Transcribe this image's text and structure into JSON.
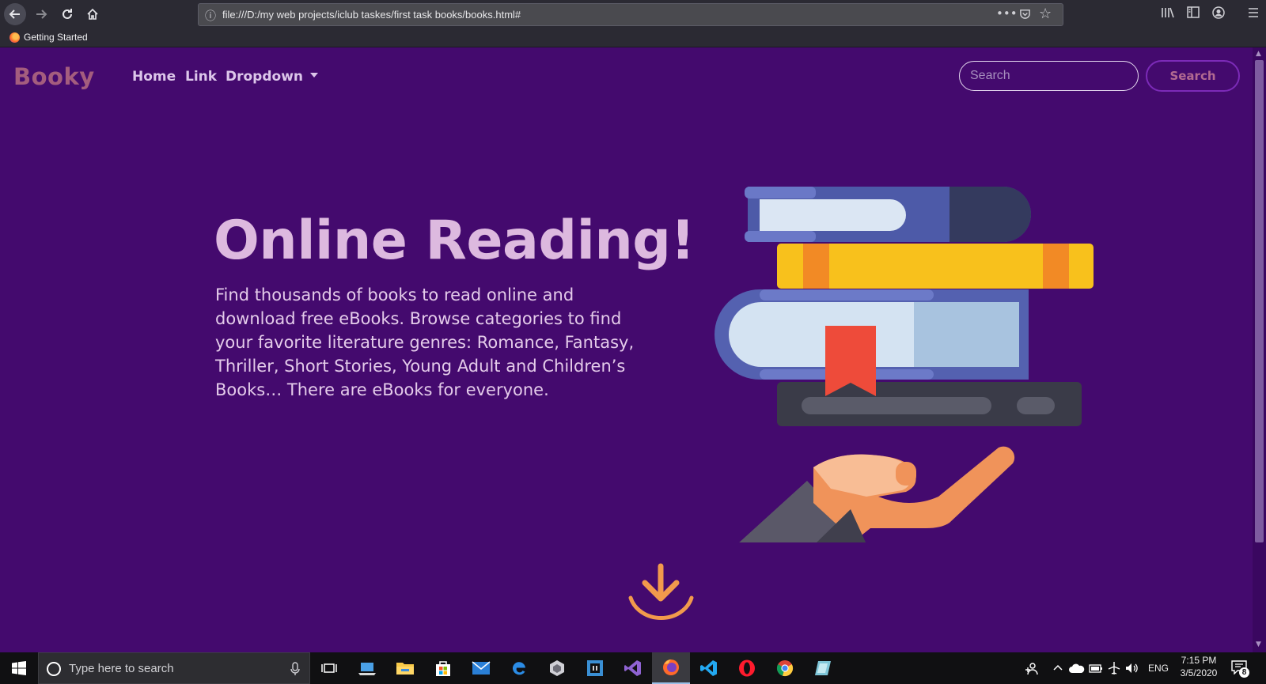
{
  "browser": {
    "url": "file:///D:/my web projects/iclub taskes/first task books/books.html#",
    "bookmarks": [
      {
        "label": "Getting Started"
      }
    ]
  },
  "page": {
    "brand": "Booky",
    "nav": {
      "home": "Home",
      "link": "Link",
      "dropdown": "Dropdown"
    },
    "search": {
      "placeholder": "Search",
      "button_label": "Search"
    },
    "hero": {
      "title": "Online Reading!",
      "text": "Find thousands of books to read online and download free eBooks. Browse categories to find your favorite literature genres: Romance, Fantasy, Thriller, Short Stories, Young Adult and Children’s Books… There are eBooks for everyone."
    },
    "colors": {
      "background": "#440a6e",
      "brand": "#a45d7e",
      "accent": "#f29a4c"
    }
  },
  "taskbar": {
    "search_placeholder": "Type here to search",
    "language": "ENG",
    "time": "7:15 PM",
    "date": "3/5/2020",
    "notification_count": "8",
    "apps": [
      "task-view",
      "laptop-app",
      "file-explorer",
      "microsoft-store",
      "mail",
      "edge",
      "game-app",
      "dev-app",
      "visual-studio",
      "firefox",
      "vscode",
      "opera",
      "chrome",
      "tool-app"
    ]
  }
}
